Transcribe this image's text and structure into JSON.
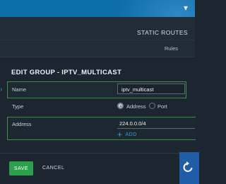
{
  "header": {
    "static_routes": "STATIC ROUTES",
    "rules": "Rules"
  },
  "dialog": {
    "title": "EDIT GROUP - IPTV_MULTICAST",
    "name": {
      "label": "Name",
      "value": "iptv_multicast"
    },
    "type": {
      "label": "Type",
      "options": [
        {
          "label": "Address",
          "selected": true
        },
        {
          "label": "Port",
          "selected": false
        }
      ]
    },
    "address": {
      "label": "Address",
      "value": "224.0.0.0/4",
      "add_label": "ADD"
    },
    "actions": {
      "save": "SAVE",
      "cancel": "CANCEL"
    }
  },
  "colors": {
    "topbar": "#0e6ea8",
    "background": "#1c2530",
    "save_button": "#2aa14a",
    "accent": "#2f9fe0",
    "highlight_border": "#3f8f48",
    "fab": "#1f5ea6"
  },
  "icons": {
    "topbar_caret": "chevron-down-icon",
    "add": "plus-icon",
    "fab": "refresh-arrow-icon"
  }
}
